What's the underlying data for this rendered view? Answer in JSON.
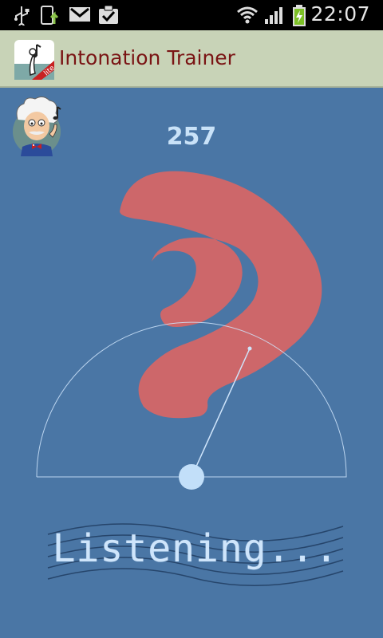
{
  "status_bar": {
    "time": "22:07",
    "icons": [
      "usb-icon",
      "upload-icon",
      "gmail-icon",
      "task-done-icon",
      "wifi-icon",
      "signal-icon",
      "battery-charging-icon"
    ]
  },
  "action_bar": {
    "title": "Intonation Trainer",
    "app_icon": "intonation-trainer-lite-icon",
    "badge": "lite"
  },
  "main": {
    "frequency": "257",
    "status_text": "Listening...",
    "pitch_indicator": "question-mark",
    "colors": {
      "background": "#4a76a5",
      "question_mark": "#cd676a",
      "needle": "#cfe5fb",
      "text": "#c9e2f8"
    }
  }
}
